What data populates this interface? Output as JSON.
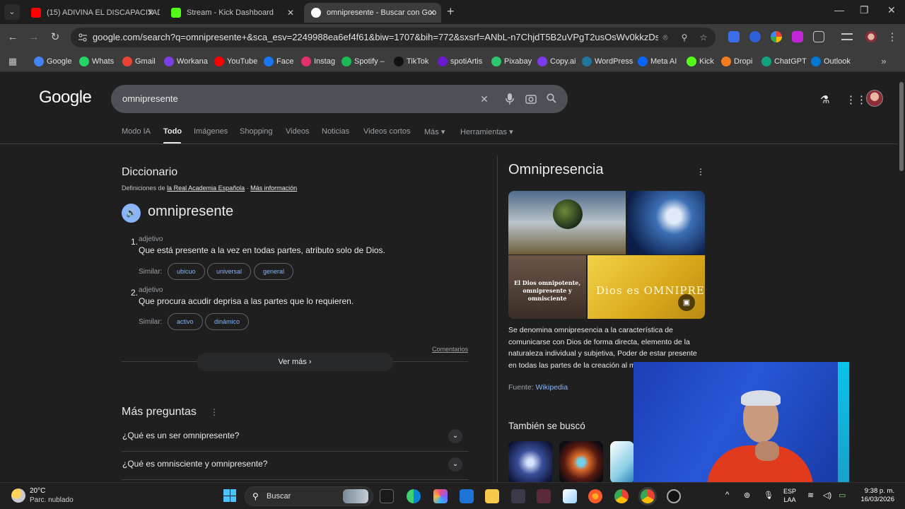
{
  "browser": {
    "tabs": [
      {
        "title": "(15) ADIVINA EL DISCAPACITAD",
        "favicon_color": "#ff0000"
      },
      {
        "title": "Stream - Kick Dashboard",
        "favicon_color": "#53fc18"
      },
      {
        "title": "omnipresente - Buscar con Goo",
        "favicon_color": "#ffffff"
      }
    ],
    "url": "google.com/search?q=omnipresente+&sca_esv=2249988ea6ef4f61&biw=1707&bih=772&sxsrf=ANbL-n7ChjdT5B2uVPgT2usOsWv0kkzDsw%3A177371...",
    "bookmarks": [
      {
        "label": "Google",
        "icon": "google-icon",
        "color": "#4285f4"
      },
      {
        "label": "Whats",
        "icon": "whatsapp-icon",
        "color": "#25d366"
      },
      {
        "label": "Gmail",
        "icon": "gmail-icon",
        "color": "#ea4335"
      },
      {
        "label": "Workana",
        "icon": "workana-icon",
        "color": "#7b3fe4"
      },
      {
        "label": "YouTube",
        "icon": "youtube-icon",
        "color": "#ff0000"
      },
      {
        "label": "Face",
        "icon": "facebook-icon",
        "color": "#1877f2"
      },
      {
        "label": "Instag",
        "icon": "instagram-icon",
        "color": "#e1306c"
      },
      {
        "label": "Spotify –",
        "icon": "spotify-icon",
        "color": "#1db954"
      },
      {
        "label": "TikTok",
        "icon": "tiktok-icon",
        "color": "#111111"
      },
      {
        "label": "spotiArtis",
        "icon": "spotify-artists-icon",
        "color": "#6a1bd1"
      },
      {
        "label": "Pixabay",
        "icon": "pixabay-icon",
        "color": "#2ec66d"
      },
      {
        "label": "Copy.ai",
        "icon": "copyai-icon",
        "color": "#7c3aed"
      },
      {
        "label": "WordPress",
        "icon": "wordpress-icon",
        "color": "#21759b"
      },
      {
        "label": "Meta AI",
        "icon": "meta-icon",
        "color": "#0866ff"
      },
      {
        "label": "Kick",
        "icon": "kick-icon",
        "color": "#53fc18"
      },
      {
        "label": "Dropi",
        "icon": "dropi-icon",
        "color": "#f57c20"
      },
      {
        "label": "ChatGPT",
        "icon": "chatgpt-icon",
        "color": "#10a37f"
      },
      {
        "label": "Outlook",
        "icon": "outlook-icon",
        "color": "#0078d4"
      }
    ]
  },
  "google": {
    "logo": "Google",
    "query": "omnipresente",
    "tabs": [
      "Modo IA",
      "Todo",
      "Imágenes",
      "Shopping",
      "Videos",
      "Noticias",
      "Videos cortos",
      "Más",
      "Herramientas"
    ],
    "active_tab": "Todo"
  },
  "dictionary": {
    "title": "Diccionario",
    "source_prefix": "Definiciones de",
    "source_link": "la Real Academia Española",
    "more_info": "Más información",
    "word": "omnipresente",
    "senses": [
      {
        "num": "1.",
        "pos": "adjetivo",
        "def": "Que está presente a la vez en todas partes, atributo solo de Dios.",
        "similar_label": "Similar:",
        "similar": [
          "ubicuo",
          "universal",
          "general"
        ]
      },
      {
        "num": "2.",
        "pos": "adjetivo",
        "def": "Que procura acudir deprisa a las partes que lo requieren.",
        "similar_label": "Similar:",
        "similar": [
          "activo",
          "dinámico"
        ]
      }
    ],
    "comments": "Comentarios",
    "see_more": "Ver más"
  },
  "more_questions": {
    "title": "Más preguntas",
    "items": [
      "¿Qué es un ser omnipresente?",
      "¿Qué es omnisciente y omnipresente?"
    ]
  },
  "knowledge_panel": {
    "title": "Omnipresencia",
    "image3_text": "El Dios omnipotente, omnipresente y omnisciente",
    "image4_text": "Dios es OMNIPRESEN",
    "description": "Se denomina omnipresencia a la característica de comunicarse con Dios de forma directa, elemento de la naturaleza individual y subjetiva, Poder de estar presente en todas las partes de la creación al m",
    "source_label": "Fuente:",
    "source_link": "Wikipedia",
    "also_searched": "También se buscó"
  },
  "taskbar": {
    "temperature": "20°C",
    "weather": "Parc. nublado",
    "search": "Buscar",
    "lang_top": "ESP",
    "lang_bottom": "LAA",
    "time": "9:38 p. m.",
    "date": "16/03/2026"
  }
}
